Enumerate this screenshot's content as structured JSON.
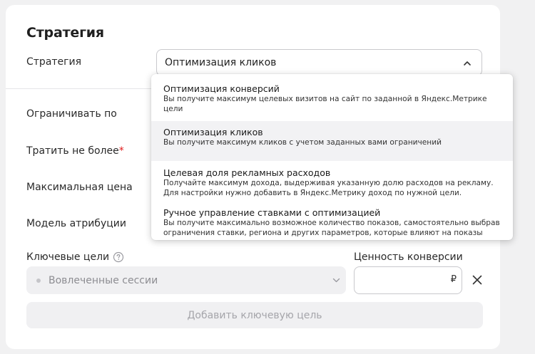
{
  "card": {
    "title": "Стратегия"
  },
  "strategy": {
    "label": "Стратегия",
    "selected": "Оптимизация кликов",
    "options": [
      {
        "title": "Оптимизация конверсий",
        "desc": "Вы получите максимум целевых визитов на сайт по заданной в Яндекс.Метрике цели"
      },
      {
        "title": "Оптимизация кликов",
        "desc": "Вы получите максимум кликов с учетом заданных вами ограничений"
      },
      {
        "title": "Целевая доля рекламных расходов",
        "desc": "Получайте максимум дохода, выдерживая указанную долю расходов на рекламу. Для настройки нужно добавить в Яндекс.Метрику доход по нужной цели."
      },
      {
        "title": "Ручное управление ставками с оптимизацией",
        "desc": "Вы получите максимально возможное количество показов, самостоятельно выбрав ограничения ставки, региона и других параметров, которые влияют на показы"
      }
    ]
  },
  "fields": {
    "limit_by": "Ограничивать по",
    "spend_max": "Тратить не более",
    "required_mark": "*",
    "max_price": "Максимальная цена",
    "attribution": "Модель атрибуции"
  },
  "goals": {
    "label": "Ключевые цели",
    "conversion_value_label": "Ценность конверсии",
    "goal_placeholder": "Вовлеченные сессии",
    "currency": "₽",
    "add_button": "Добавить ключевую цель"
  }
}
